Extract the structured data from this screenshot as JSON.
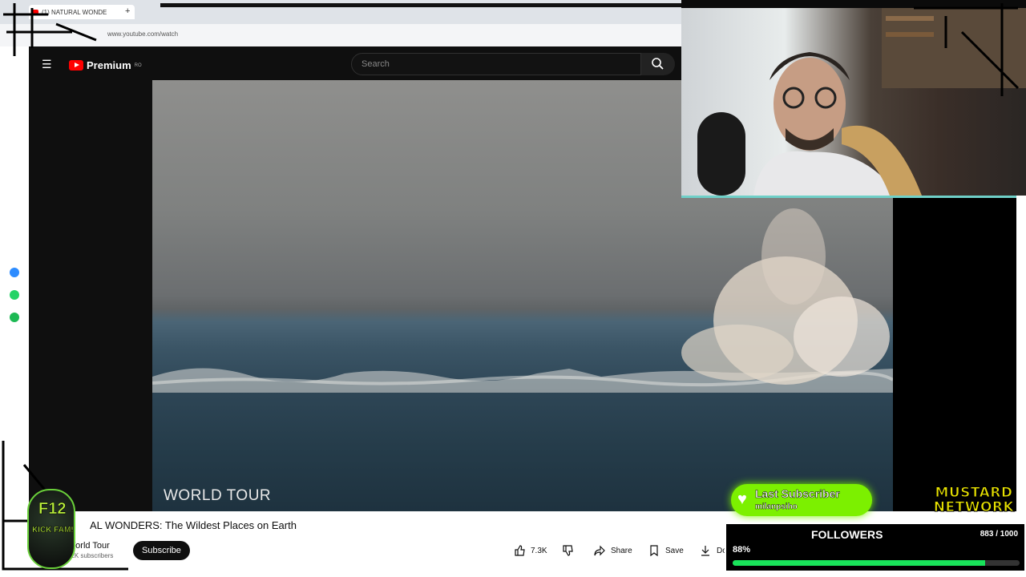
{
  "browser": {
    "tab_title": "(1) NATURAL WONDE",
    "new_tab": "+",
    "url": "www.youtube.com/watch"
  },
  "youtube": {
    "logo_text": "Premium",
    "logo_region": "RO",
    "search_placeholder": "Search",
    "video_overlay": "WORLD TOUR",
    "video_title": "AL WONDERS: The Wildest Places on Earth",
    "channel_name": "World Tour",
    "subscriber_count": "22K subscribers",
    "subscribe_label": "Subscribe",
    "like_count": "7.3K",
    "share_label": "Share",
    "save_label": "Save",
    "download_label": "Do"
  },
  "overlays": {
    "last_subscriber_label": "Last Subscriber",
    "last_subscriber_name": "milanpsiho",
    "brand_line1": "MUSTARD",
    "brand_line2": "NETWORK",
    "followers_label": "FOLLOWERS",
    "followers_count": "883 / 1000",
    "followers_percent_text": "88%",
    "followers_progress": 0.88,
    "badge_line1": "F12",
    "badge_line2": "KICK FAM!"
  },
  "colors": {
    "youtube_red": "#ff0000",
    "overlay_green": "#7cf000",
    "progress_green": "#19e35a",
    "brand_yellow": "#e8e200"
  }
}
